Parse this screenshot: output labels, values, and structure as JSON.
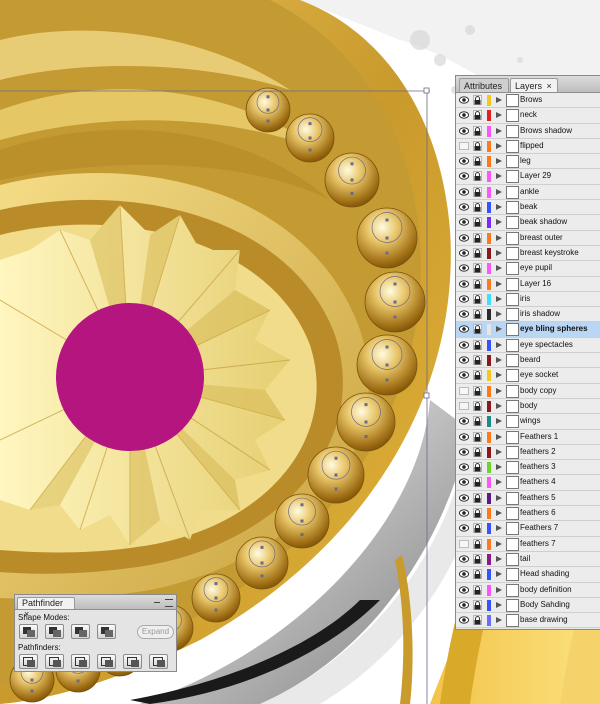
{
  "layers_panel": {
    "tabs": [
      {
        "label": "Attributes",
        "active": false
      },
      {
        "label": "Layers",
        "active": true
      }
    ],
    "close_glyph": "×",
    "items": [
      {
        "name": "Brows",
        "color": "#f6c81e",
        "visible": true
      },
      {
        "name": "neck",
        "color": "#e02020",
        "visible": true
      },
      {
        "name": "Brows shadow",
        "color": "#ff55ff",
        "visible": true
      },
      {
        "name": "flipped",
        "color": "#ff7a1a",
        "visible": false
      },
      {
        "name": "leg",
        "color": "#ff7a1a",
        "visible": true
      },
      {
        "name": "Layer 29",
        "color": "#ff55ff",
        "visible": true
      },
      {
        "name": "ankle",
        "color": "#ff55ff",
        "visible": true
      },
      {
        "name": "beak",
        "color": "#3553ff",
        "visible": true
      },
      {
        "name": "beak shadow",
        "color": "#7a2aff",
        "visible": true
      },
      {
        "name": "breast outer",
        "color": "#ff7a1a",
        "visible": true
      },
      {
        "name": "breast keystroke",
        "color": "#8a1a1a",
        "visible": true
      },
      {
        "name": "eye pupil",
        "color": "#ff55ff",
        "visible": true
      },
      {
        "name": "Layer 16",
        "color": "#ff7a1a",
        "visible": true
      },
      {
        "name": "iris",
        "color": "#3fe0ff",
        "visible": true
      },
      {
        "name": "iris shadow",
        "color": "#2b2b2b",
        "visible": true
      },
      {
        "name": "eye bling spheres",
        "color": "#e6e6e6",
        "visible": true,
        "selected": true
      },
      {
        "name": "eye spectacles",
        "color": "#3553ff",
        "visible": true
      },
      {
        "name": "beard",
        "color": "#8a1a1a",
        "visible": true
      },
      {
        "name": "eye socket",
        "color": "#f6c81e",
        "visible": true
      },
      {
        "name": "body copy",
        "color": "#ff7a1a",
        "visible": false
      },
      {
        "name": "body",
        "color": "#8a1a1a",
        "visible": false
      },
      {
        "name": "wings",
        "color": "#1a8a8a",
        "visible": true
      },
      {
        "name": "Feathers 1",
        "color": "#ff7a1a",
        "visible": true
      },
      {
        "name": "feathers 2",
        "color": "#8a1a1a",
        "visible": true
      },
      {
        "name": "feathers 3",
        "color": "#6bd62a",
        "visible": true
      },
      {
        "name": "feathers 4",
        "color": "#ff55ff",
        "visible": true
      },
      {
        "name": "feathers 5",
        "color": "#5a1a8a",
        "visible": true
      },
      {
        "name": "feathers 6",
        "color": "#ff7a1a",
        "visible": true
      },
      {
        "name": "Feathers 7",
        "color": "#3553ff",
        "visible": true
      },
      {
        "name": "feathers 7",
        "color": "#ff7a1a",
        "visible": false
      },
      {
        "name": "tail",
        "color": "#8a1a8a",
        "visible": true
      },
      {
        "name": "Head shading",
        "color": "#3553ff",
        "visible": true
      },
      {
        "name": "body definition",
        "color": "#ff55ff",
        "visible": true
      },
      {
        "name": "Body Sahding",
        "color": "#3553ff",
        "visible": true
      },
      {
        "name": "base drawing",
        "color": "#6b6bff",
        "visible": true
      }
    ]
  },
  "pathfinder_panel": {
    "title": "Pathfinder",
    "close_glyph": "×",
    "shape_modes_label": "Shape Modes:",
    "pathfinders_label": "Pathfinders:",
    "expand_label": "Expand",
    "icons": {
      "shape_modes": [
        "unite-icon",
        "minus-front-icon",
        "intersect-icon",
        "exclude-icon"
      ],
      "pathfinders": [
        "divide-icon",
        "trim-icon",
        "merge-icon",
        "crop-icon",
        "outline-icon",
        "minus-back-icon"
      ]
    }
  },
  "artwork": {
    "pupil_color": "#b5157e",
    "gold_light": "#f8e9a0",
    "gold_mid": "#d4a93a",
    "gold_dark": "#9c6b12",
    "selection_color": "#6a6a8a"
  }
}
